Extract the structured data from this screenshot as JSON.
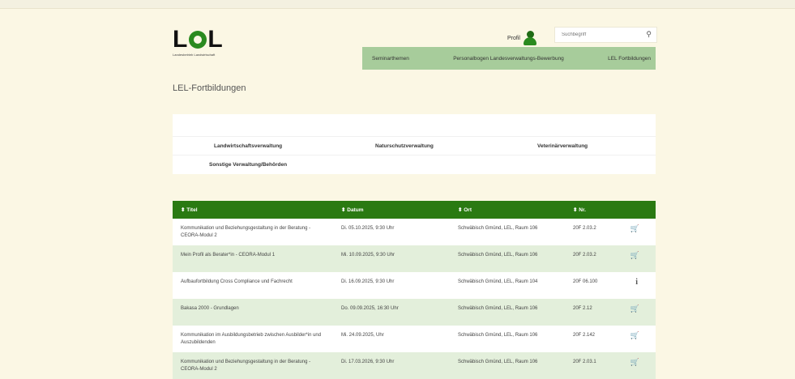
{
  "header": {
    "logo_text_left": "L",
    "logo_text_right": "L",
    "logo_subtitle": "Landesbetrieb Landwirtschaft",
    "profile_label": "Profil",
    "search_placeholder": "Suchbegriff"
  },
  "topnav": {
    "items": [
      {
        "label": "Seminarthemen"
      },
      {
        "label": "Personalbogen Landesverwaltungs-Bewerbung"
      },
      {
        "label": "LEL Fortbildungen"
      }
    ]
  },
  "page_title": "LEL-Fortbildungen",
  "categories": [
    {
      "label": "Landwirtschaftsverwaltung"
    },
    {
      "label": "Naturschutzverwaltung"
    },
    {
      "label": "Veterinärverwaltung"
    },
    {
      "label": "Sonstige Verwaltung/Behörden"
    }
  ],
  "table": {
    "headers": [
      "⬍ Titel",
      "⬍ Datum",
      "⬍ Ort",
      "⬍ Nr."
    ],
    "rows": [
      {
        "title": "Kommunikation und Beziehungsgestaltung in der Beratung - CEORA-Modul 2",
        "date": "Di. 05.10.2025, 9:30 Uhr",
        "place": "Schwäbisch Gmünd, LEL, Raum 106",
        "nr": "20F 2.03.2",
        "icon": "cart",
        "color": "#d62b2b"
      },
      {
        "title": "Mein Profil als Berater*in - CEORA-Modul 1",
        "date": "Mi. 10.09.2025, 9:30 Uhr",
        "place": "Schwäbisch Gmünd, LEL, Raum 106",
        "nr": "20F 2.03.2",
        "icon": "cart",
        "color": "#2a7a12"
      },
      {
        "title": "Aufbaufortbildung Cross Compliance und Fachrecht",
        "date": "Di. 16.09.2025, 9:30 Uhr",
        "place": "Schwäbisch Gmünd, LEL, Raum 104",
        "nr": "20F 06.100",
        "icon": "info",
        "color": "#555555"
      },
      {
        "title": "Bakasa 2000 - Grundlagen",
        "date": "Do. 09.09.2025, 16:30 Uhr",
        "place": "Schwäbisch Gmünd, LEL, Raum 106",
        "nr": "20F 2.12",
        "icon": "cart",
        "color": "#2a7a12"
      },
      {
        "title": "Kommunikation im Ausbildungsbetrieb zwischen Ausbilder*in und Auszubildenden",
        "date": "Mi. 24.09.2025, Uhr",
        "place": "Schwäbisch Gmünd, LEL, Raum 106",
        "nr": "20F 2.142",
        "icon": "cart",
        "color": "#2a7a12"
      },
      {
        "title": "Kommunikation und Beziehungsgestaltung in der Beratung - CEORA-Modul 2",
        "date": "Di. 17.03.2026, 9:30 Uhr",
        "place": "Schwäbisch Gmünd, LEL, Raum 106",
        "nr": "20F 2.03.1",
        "icon": "cart",
        "color": "#2a7a12"
      }
    ]
  }
}
